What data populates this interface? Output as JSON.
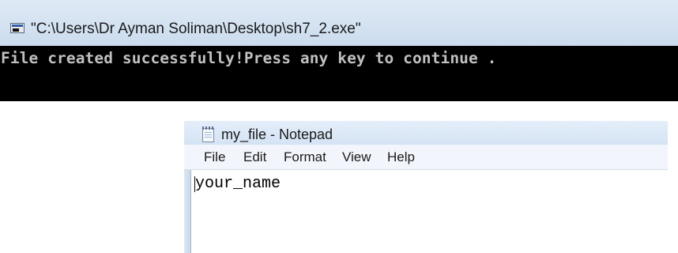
{
  "console": {
    "icon": "console-window-icon",
    "title": "\"C:\\Users\\Dr Ayman Soliman\\Desktop\\sh7_2.exe\"",
    "output": "File created successfully!Press any key to continue ."
  },
  "notepad": {
    "icon": "notepad-icon",
    "title": "my_file - Notepad",
    "menu": [
      {
        "label": "File"
      },
      {
        "label": "Edit"
      },
      {
        "label": "Format"
      },
      {
        "label": "View"
      },
      {
        "label": "Help"
      }
    ],
    "content": "your_name"
  }
}
